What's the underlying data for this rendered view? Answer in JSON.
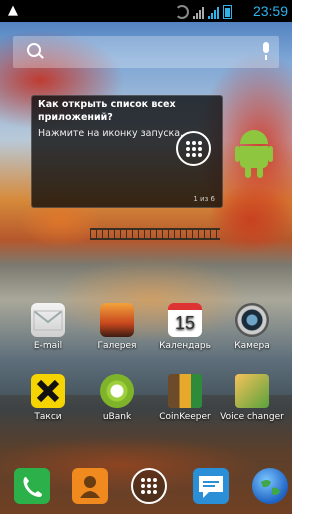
{
  "status_bar": {
    "time": "23:59"
  },
  "search_bar": {},
  "onboarding_tip": {
    "title": "Как открыть список всех приложений?",
    "body": "Нажмите на иконку запуска.",
    "counter": "1 из 6"
  },
  "home_apps": [
    {
      "label": "E-mail"
    },
    {
      "label": "Галерея"
    },
    {
      "label": "Календарь"
    },
    {
      "label": "Камера"
    },
    {
      "label": "Такси"
    },
    {
      "label": "uBank"
    },
    {
      "label": "CoinKeeper"
    },
    {
      "label": "Voice changer"
    }
  ],
  "calendar_day": "15",
  "dock": {
    "items": [
      "phone",
      "contacts",
      "apps-launcher",
      "messaging",
      "browser"
    ]
  },
  "colors": {
    "status_accent": "#2fb3e8",
    "android_green": "#8ec63f"
  }
}
